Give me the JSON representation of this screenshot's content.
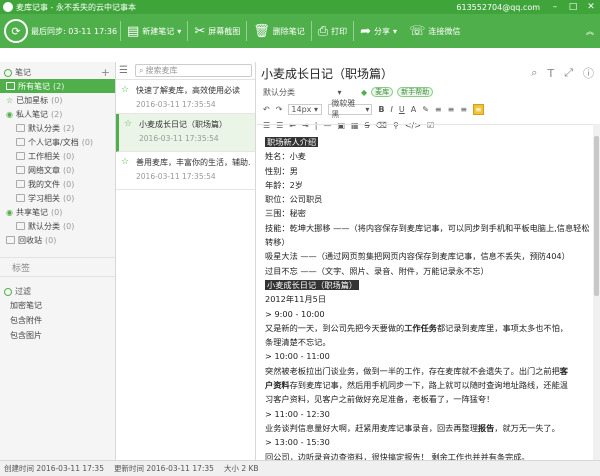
{
  "titlebar": {
    "title": "麦库记事 - 永不丢失的云中记事本",
    "account": "613552704@qq.com",
    "min": "–",
    "max": "□",
    "close": "✕"
  },
  "toolbar": {
    "sync_label": "最后同步: 03-11 17:36",
    "new_note": "新建笔记",
    "screenshot": "屏幕截图",
    "delete_note": "删除笔记",
    "print": "打印",
    "share": "分享",
    "wechat": "连接微信"
  },
  "left": {
    "notes_header": "笔记",
    "items": [
      {
        "label": "所有笔记",
        "count": "(2)"
      },
      {
        "label": "已加星标",
        "count": "(0)"
      }
    ],
    "private_header": "私人笔记",
    "private_count": "(2)",
    "private_items": [
      {
        "label": "默认分类",
        "count": "(2)"
      },
      {
        "label": "个人记事/文档",
        "count": "(0)"
      },
      {
        "label": "工作相关",
        "count": "(0)"
      },
      {
        "label": "网络文章",
        "count": "(0)"
      },
      {
        "label": "我的文件",
        "count": "(0)"
      },
      {
        "label": "学习相关",
        "count": "(0)"
      }
    ],
    "shared_header": "共享笔记",
    "shared_count": "(0)",
    "shared_items": [
      {
        "label": "默认分类",
        "count": "(0)"
      }
    ],
    "recycle": "回收站",
    "recycle_count": "(0)",
    "tags": "标签",
    "filter_header": "过滤",
    "filter_items": [
      "加密笔记",
      "包含附件",
      "包含图片"
    ]
  },
  "middle": {
    "search_placeholder": "搜索麦库",
    "notes": [
      {
        "title": "快速了解麦库，高效使用必读",
        "date": "2016-03-11 17:35:54"
      },
      {
        "title": "小麦成长日记（职场篇）",
        "date": "2016-03-11 17:35:54"
      },
      {
        "title": "善用麦库，丰富你的生活，辅助...",
        "date": "2016-03-11 17:35:54"
      }
    ]
  },
  "editor": {
    "title": "小麦成长日记（职场篇）",
    "category": "默认分类",
    "tags": [
      "麦库",
      "新手帮助"
    ],
    "font_size": "14px",
    "font_family": "微软雅黑",
    "content": {
      "h1": "职场新人介绍",
      "lines1": [
        "姓名：小麦",
        "性别：男",
        "年龄：2岁",
        "职位：公司职员",
        "三围：秘密"
      ],
      "skill": "技能：乾坤大挪移 ——（将内容保存到麦库记事，可以同步到手机和平板电脑上,信息轻松转移）",
      "skill_wrap": "",
      "suck": "吸星大法 ——（通过网页剪集把网页内容保存到麦库记事，信息不丢失，预防404）",
      "memory": "过目不忘 ——（文字、照片、录音、附件，万能记录永不忘）",
      "h2": "小麦成长日记（职场篇）",
      "date": "2012年11月5日",
      "t1": "> 9:00 - 10:00",
      "p1a": "又是新的一天，到公司先把今天要做的",
      "p1b": "工作任务",
      "p1c": "都记录到麦库里，事项太多也不怕，",
      "p1d": "条理清楚不忘记。",
      "t2": "> 10:00 - 11:00",
      "p2a": "突然被老板拉出门谈业务，做到一半的工作，存在麦库就不会遗失了。出门之前把",
      "p2b": "客",
      "p2c": "户资料",
      "p2d": "存到麦库记事，然后用手机同步一下，路上就可以随时查询地址路线，还能温",
      "p2e": "习客户资料，见客户之前做好充足准备，老板看了，一阵猛夸！",
      "t3": "> 11:00 - 12:30",
      "p3a": "业务谈判信息量好大啊，赶紧用麦库记事录音，回去再整理",
      "p3b": "报告",
      "p3c": "，就万无一失了。",
      "t4": "> 13:00 - 15:30",
      "p4a": "回公司，边听录音边查资料，很快搞定报告！ 剩余工作也并并有条完成。"
    }
  },
  "status": {
    "created": "创建时间 2016-03-11 17:35",
    "updated": "更新时间 2016-03-11 17:35",
    "size": "大小 2 KB"
  }
}
